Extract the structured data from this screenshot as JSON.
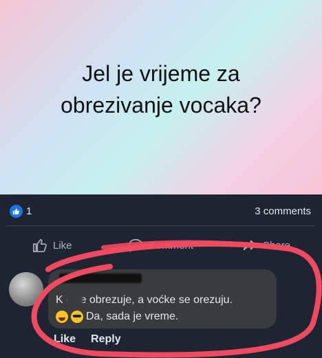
{
  "post": {
    "text": "Jel je vrijeme za obrezivanje vocaka?"
  },
  "reactions": {
    "like_count": "1",
    "comments_count": "3 comments"
  },
  "actions": {
    "like": "Like",
    "comment": "Comment",
    "share": "Share"
  },
  "comment": {
    "line1": "K  c se obrezuje, a voćke se orezuju.",
    "line2": "Da, sada je vreme.",
    "like": "Like",
    "reply": "Reply"
  },
  "colors": {
    "accent": "#1b74e4",
    "background": "#1f2433",
    "bubble": "#3a3b3c",
    "highlight": "#ef4a5f"
  }
}
